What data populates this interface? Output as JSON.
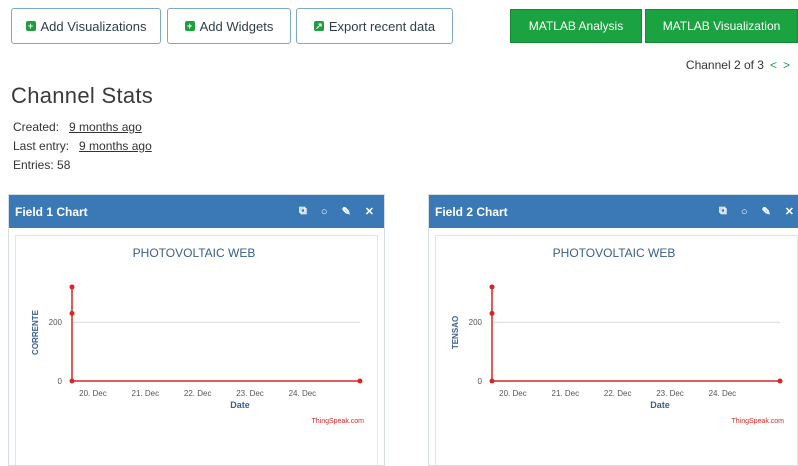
{
  "toolbar": {
    "add_visualizations": "Add Visualizations",
    "add_widgets": "Add Widgets",
    "export_recent": "Export recent data",
    "matlab_analysis": "MATLAB Analysis",
    "matlab_visualization": "MATLAB Visualization"
  },
  "pager": {
    "label": "Channel 2 of 3",
    "prev": "<",
    "next": ">"
  },
  "channel": {
    "title": "Channel Stats",
    "created_label": "Created:",
    "created_value": "9 months ago",
    "last_entry_label": "Last entry:",
    "last_entry_value": "9 months ago",
    "entries_label": "Entries: 58"
  },
  "panels": [
    {
      "title": "Field 1 Chart"
    },
    {
      "title": "Field 2 Chart"
    }
  ],
  "colors": {
    "panel_header": "#3a78b6",
    "green": "#1aa340",
    "series": "#d62728",
    "title_blue": "#3a5e8c"
  },
  "chart_data": [
    {
      "type": "line",
      "title": "PHOTOVOLTAIC WEB",
      "xlabel": "Date",
      "ylabel": "CORRENTE",
      "xticks": [
        "20. Dec",
        "21. Dec",
        "22. Dec",
        "23. Dec",
        "24. Dec"
      ],
      "yticks": [
        0,
        200
      ],
      "ylim": [
        0,
        330
      ],
      "credit": "ThingSpeak.com",
      "series": [
        {
          "x": [
            19.6,
            19.6,
            19.6,
            25.1
          ],
          "y": [
            320,
            230,
            0,
            0
          ]
        }
      ]
    },
    {
      "type": "line",
      "title": "PHOTOVOLTAIC WEB",
      "xlabel": "Date",
      "ylabel": "TENSAO",
      "xticks": [
        "20. Dec",
        "21. Dec",
        "22. Dec",
        "23. Dec",
        "24. Dec"
      ],
      "yticks": [
        0,
        200
      ],
      "ylim": [
        0,
        330
      ],
      "credit": "ThingSpeak.com",
      "series": [
        {
          "x": [
            19.6,
            19.6,
            19.6,
            25.1
          ],
          "y": [
            320,
            230,
            0,
            0
          ]
        }
      ]
    }
  ]
}
